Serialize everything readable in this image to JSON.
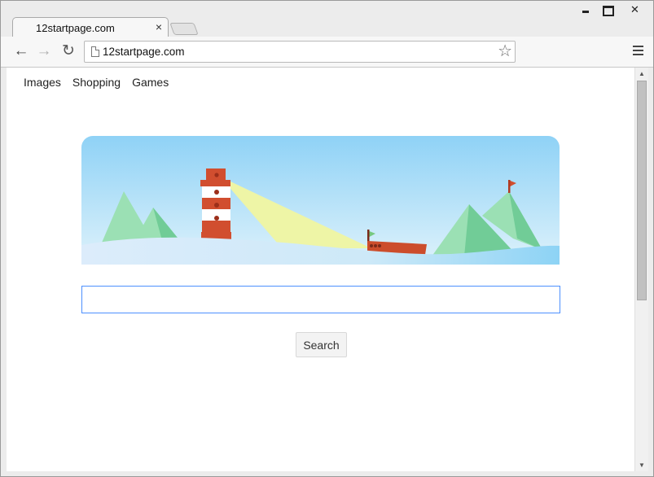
{
  "browser": {
    "tab_title": "12startpage.com",
    "tab_close": "×",
    "url": "12startpage.com",
    "star": "☆"
  },
  "toolbar_icons": {
    "back": "←",
    "forward": "→",
    "reload": "↻"
  },
  "scrollbar": {
    "up": "▲",
    "down": "▼"
  },
  "page": {
    "links": [
      "Images",
      "Shopping",
      "Games"
    ],
    "search_value": "",
    "search_button": "Search"
  },
  "colors": {
    "sky_top": "#8fd2f6",
    "sky_bottom": "#def2fb",
    "mountain": "#9be0b4",
    "mountain_dark": "#71cc97",
    "lighthouse_red": "#d14e2f",
    "beam": "#eef5a6",
    "boat": "#cc4d2c",
    "focus_border": "#4d90fe"
  }
}
